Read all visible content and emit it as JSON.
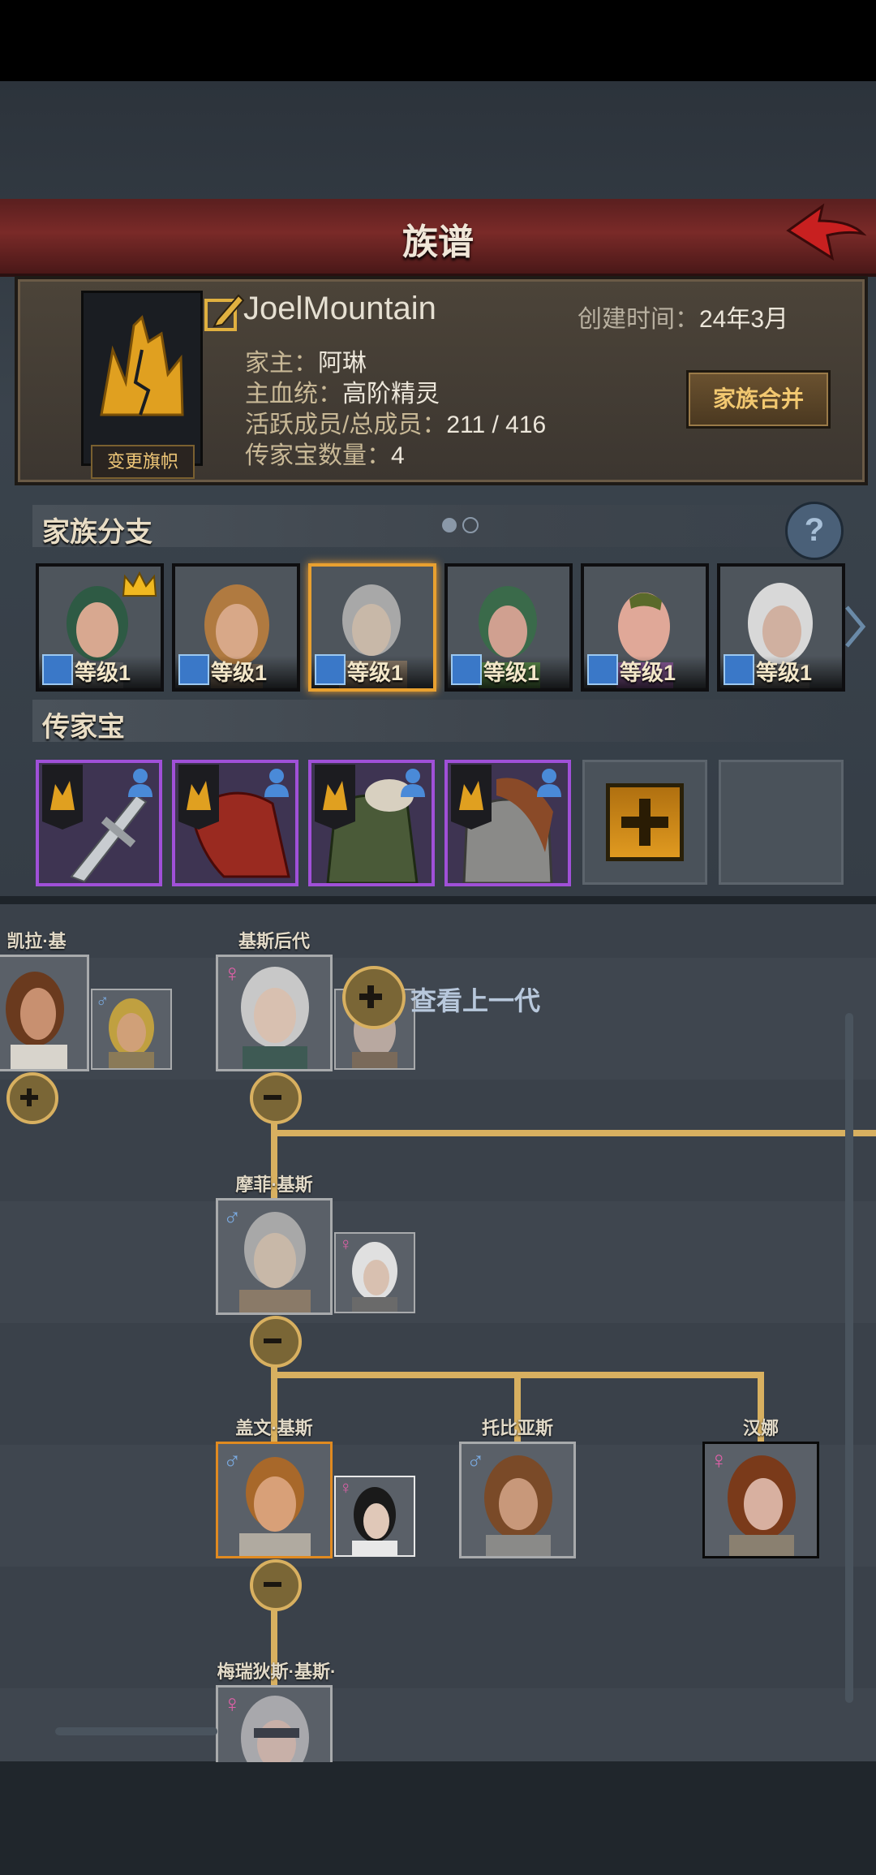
{
  "header": {
    "title": "族谱"
  },
  "family": {
    "name": "JoelMountain",
    "created_label": "创建时间：",
    "created_value": "24年3月",
    "banner_change_label": "变更旗帜",
    "merge_label": "家族合并",
    "lines": [
      {
        "label": "家主：",
        "value": "阿琳"
      },
      {
        "label": "主血统：",
        "value": "高阶精灵"
      },
      {
        "label": "活跃成员/总成员：",
        "value": "211 / 416"
      },
      {
        "label": "传家宝数量：",
        "value": "4"
      }
    ]
  },
  "branches": {
    "title": "家族分支",
    "help": "?",
    "selected_index": 2,
    "items": [
      {
        "level": "等级1",
        "leader": true
      },
      {
        "level": "等级1"
      },
      {
        "level": "等级1"
      },
      {
        "level": "等级1"
      },
      {
        "level": "等级1"
      },
      {
        "level": "等级1"
      }
    ]
  },
  "heirlooms": {
    "title": "传家宝",
    "items": [
      "sword",
      "red-cape",
      "green-armor",
      "chain-armor"
    ],
    "add_icon": "plus-icon"
  },
  "tree": {
    "view_previous": "查看上一代",
    "names": {
      "left_member": "凯拉·基斯",
      "descendant": "基斯后代",
      "mofei": "摩菲·基斯",
      "gaiwen": "盖文·基斯",
      "tobias": "托比亚斯",
      "hanna": "汉娜",
      "meiruidi": "梅瑞狄斯·基斯·"
    }
  },
  "colors": {
    "accent_gold": "#d8b060",
    "title_red": "#7a2a28",
    "epic_purple": "#a050d8"
  }
}
